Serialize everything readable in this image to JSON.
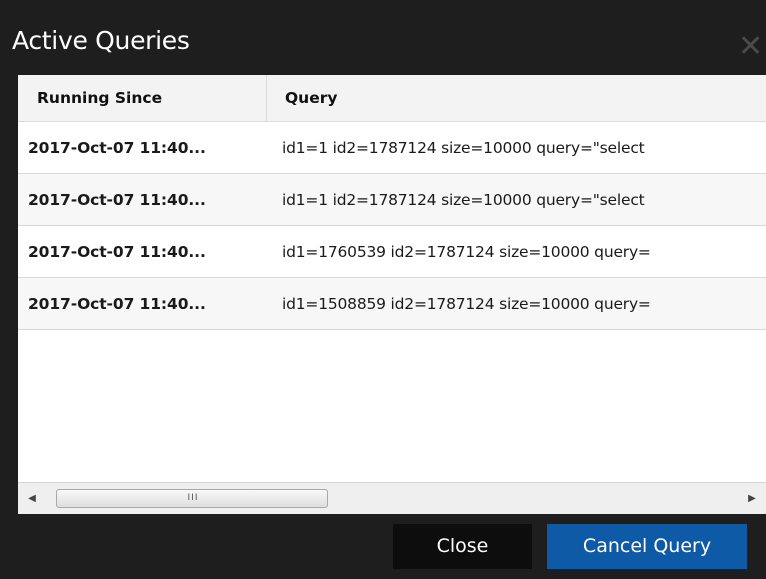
{
  "dialog": {
    "title": "Active Queries",
    "close_icon": "close-icon"
  },
  "table": {
    "columns": [
      "Running Since",
      "Query"
    ],
    "rows": [
      {
        "running_since": "2017-Oct-07 11:40...",
        "query": "id1=1 id2=1787124 size=10000 query=\"select"
      },
      {
        "running_since": "2017-Oct-07 11:40...",
        "query": "id1=1 id2=1787124 size=10000 query=\"select"
      },
      {
        "running_since": "2017-Oct-07 11:40...",
        "query": "id1=1760539 id2=1787124 size=10000 query="
      },
      {
        "running_since": "2017-Oct-07 11:40...",
        "query": "id1=1508859 id2=1787124 size=10000 query="
      }
    ]
  },
  "scrollbar": {
    "left_arrow": "◀",
    "right_arrow": "▶",
    "grip": "III"
  },
  "buttons": {
    "close_label": "Close",
    "cancel_label": "Cancel Query"
  },
  "colors": {
    "dialog_background": "#1e1e1e",
    "primary_button": "#0f5aa6",
    "secondary_button": "#0d0d0d"
  }
}
